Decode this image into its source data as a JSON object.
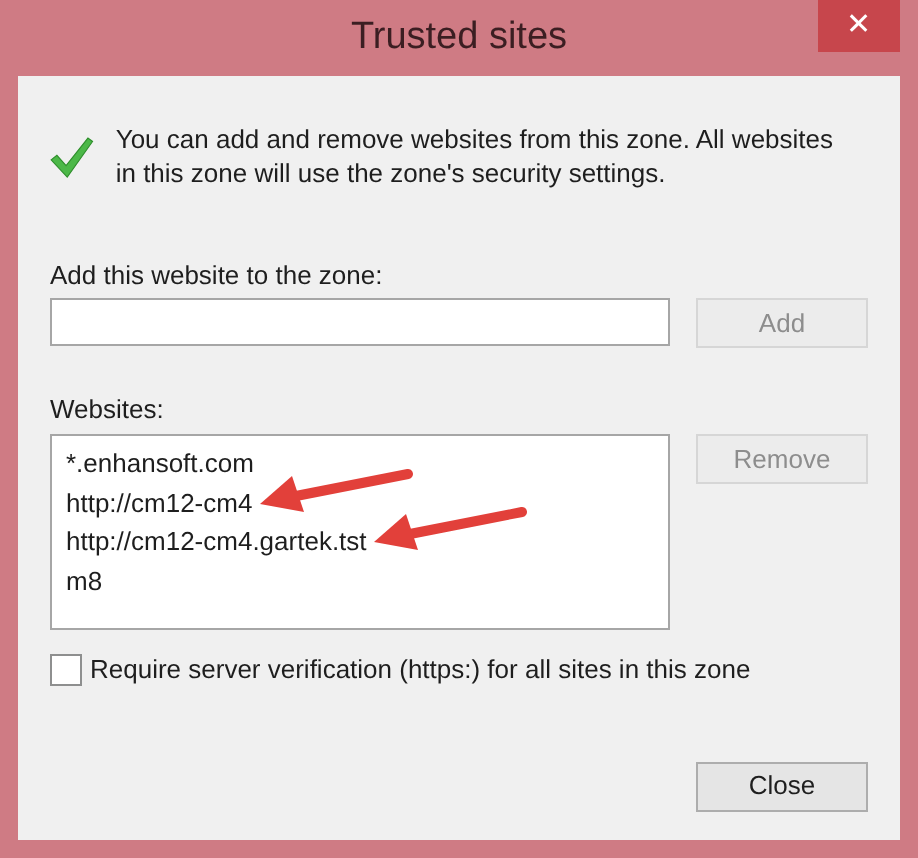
{
  "window": {
    "title": "Trusted sites",
    "close_glyph": "✕"
  },
  "info_text": "You can add and remove websites from this zone. All websites in this zone will use the zone's security settings.",
  "add_field": {
    "label": "Add this website to the zone:"
  },
  "add_button": {
    "label": "Add",
    "disabled": true
  },
  "websites": {
    "label": "Websites:",
    "items": [
      {
        "text": "*.enhansoft.com",
        "arrow": false
      },
      {
        "text": "http://cm12-cm4",
        "arrow": true
      },
      {
        "text": "http://cm12-cm4.gartek.tst",
        "arrow": true
      },
      {
        "text": "m8",
        "arrow": false
      }
    ]
  },
  "remove_button": {
    "label": "Remove",
    "disabled": true
  },
  "require_verification": {
    "label": "Require server verification (https:) for all sites in this zone",
    "checked": false
  },
  "close_button": {
    "label": "Close",
    "disabled": false
  }
}
